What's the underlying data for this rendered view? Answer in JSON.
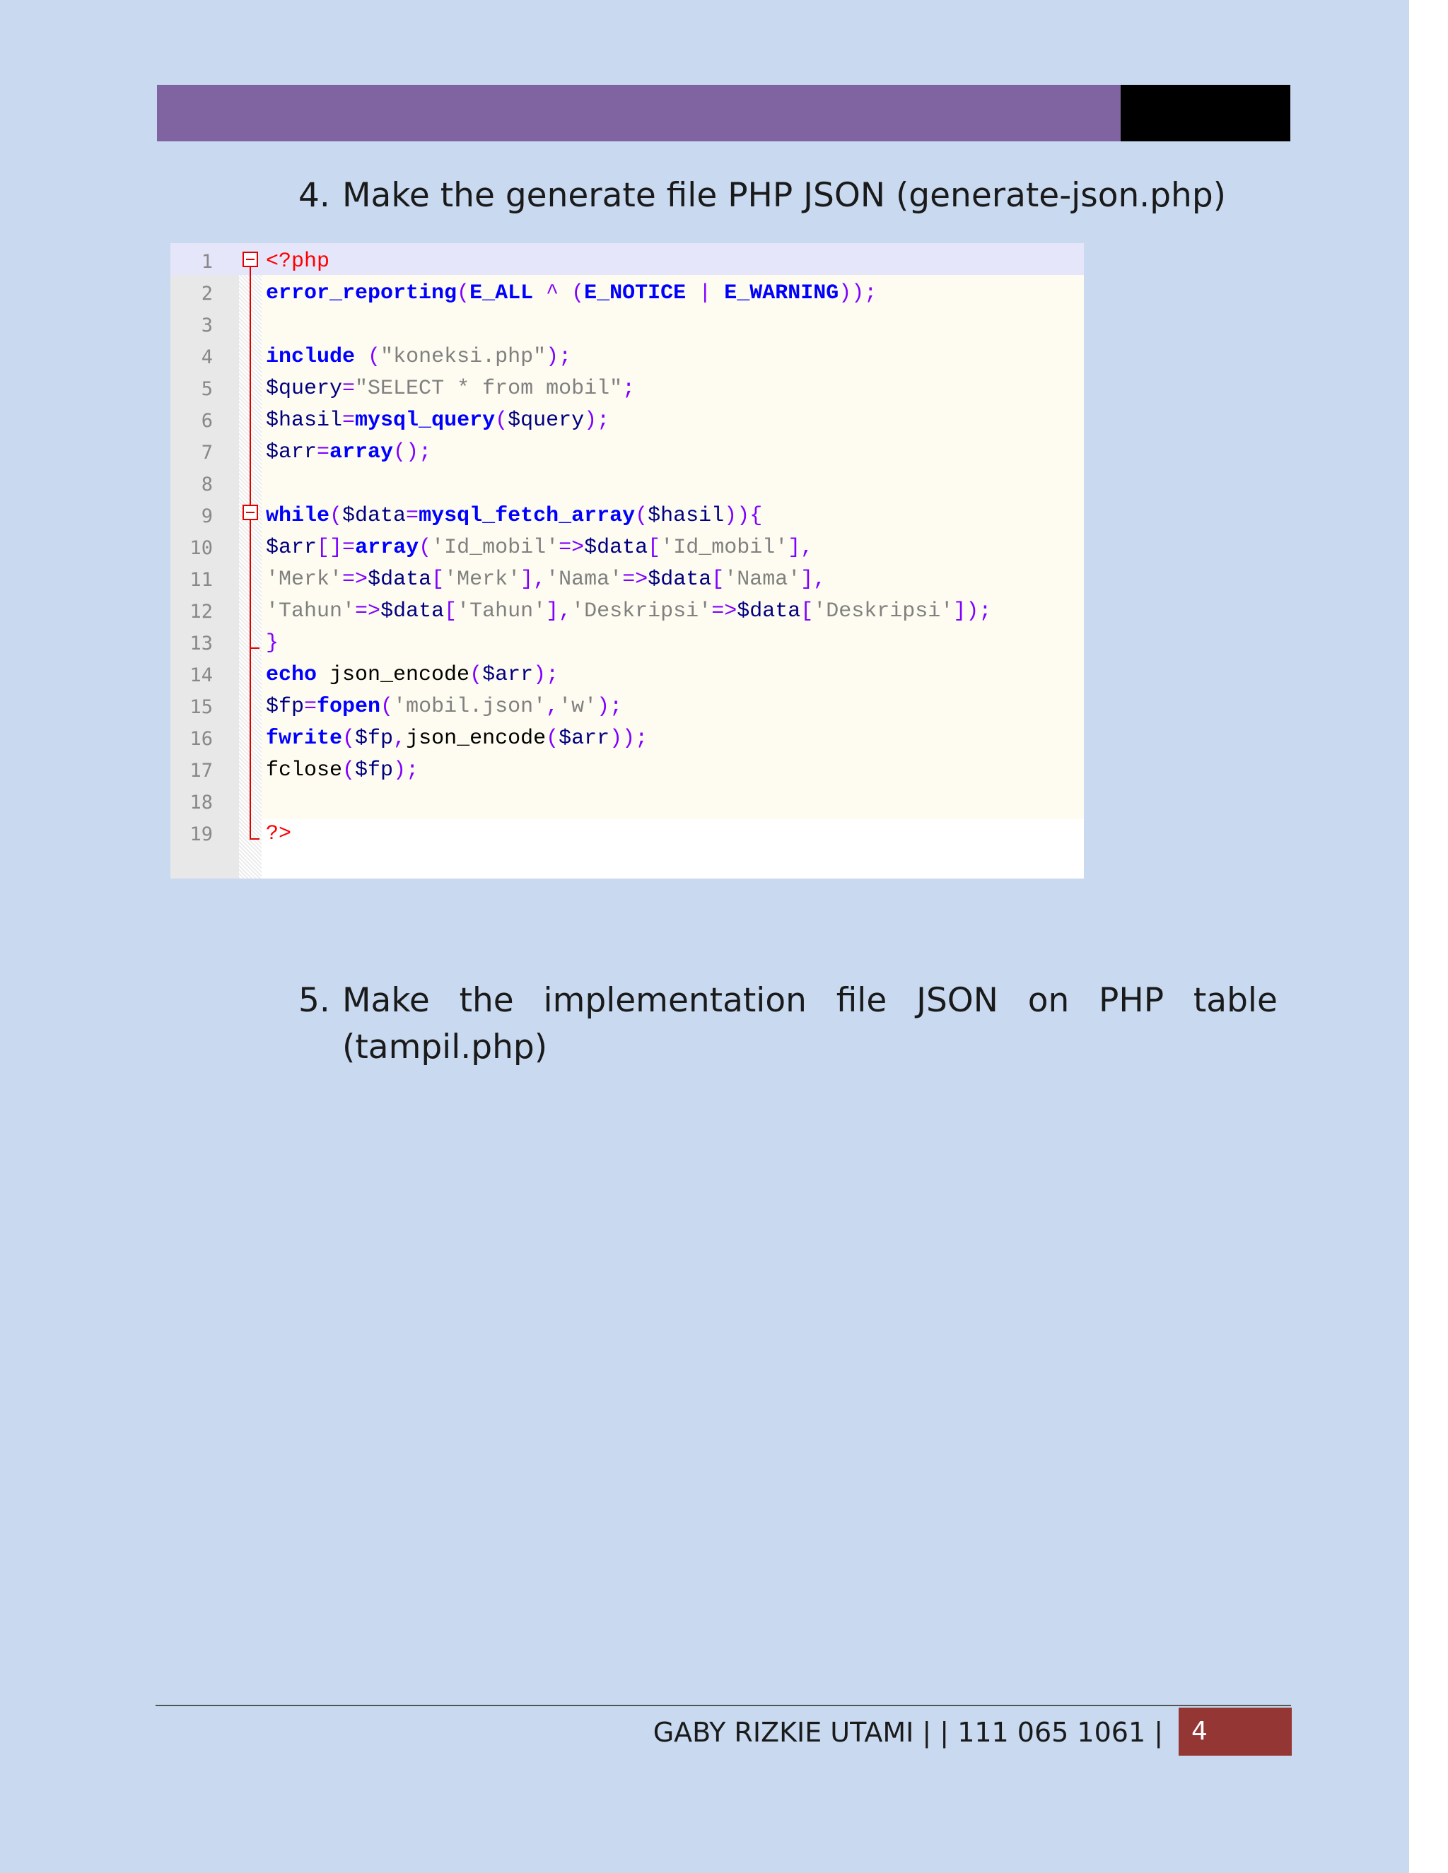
{
  "header": {
    "accent_color": "#8064a2",
    "end_block_color": "#000000"
  },
  "steps": [
    {
      "number": "4.",
      "text": "Make the generate file PHP JSON (generate-json.php)"
    },
    {
      "number": "5.",
      "words_line1": [
        "Make",
        "the",
        "implementation",
        "file",
        "JSON",
        "on",
        "PHP",
        "table"
      ],
      "line2": "(tampil.php)"
    }
  ],
  "code_screenshot": {
    "language": "php",
    "line_numbers": [
      "1",
      "2",
      "3",
      "4",
      "5",
      "6",
      "7",
      "8",
      "9",
      "10",
      "11",
      "12",
      "13",
      "14",
      "15",
      "16",
      "17",
      "18",
      "19"
    ],
    "lines": [
      "<?php",
      "error_reporting(E_ALL ^ (E_NOTICE | E_WARNING));",
      "",
      "include (\"koneksi.php\");",
      "$query=\"SELECT * from mobil\";",
      "$hasil=mysql_query($query);",
      "$arr=array();",
      "",
      "while($data=mysql_fetch_array($hasil)){",
      "$arr[]=array('Id_mobil'=>$data['Id_mobil'],",
      "'Merk'=>$data['Merk'],'Nama'=>$data['Nama'],",
      "'Tahun'=>$data['Tahun'],'Deskripsi'=>$data['Deskripsi']);",
      "}",
      "echo json_encode($arr);",
      "$fp=fopen('mobil.json','w');",
      "fwrite($fp,json_encode($arr));",
      "fclose($fp);",
      "",
      "?>"
    ]
  },
  "footer": {
    "text": "GABY RIZKIE UTAMI | | 111 065 1061 |",
    "page_number": "4",
    "badge_color": "#943634"
  }
}
